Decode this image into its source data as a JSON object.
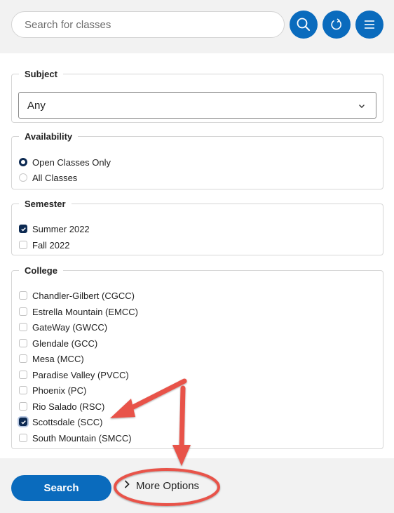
{
  "header": {
    "search_placeholder": "Search for classes",
    "buttons": [
      {
        "name": "search",
        "icon": "search-icon"
      },
      {
        "name": "reset",
        "icon": "refresh-icon"
      },
      {
        "name": "menu",
        "icon": "hamburger-menu-icon"
      }
    ]
  },
  "filters": {
    "subject": {
      "legend": "Subject",
      "selected": "Any",
      "icon": "chevron-down-icon"
    },
    "availability": {
      "legend": "Availability",
      "options": [
        {
          "label": "Open Classes Only",
          "selected": true
        },
        {
          "label": "All Classes",
          "selected": false
        }
      ]
    },
    "semester": {
      "legend": "Semester",
      "options": [
        {
          "label": "Summer 2022",
          "checked": true
        },
        {
          "label": "Fall 2022",
          "checked": false
        }
      ]
    },
    "college": {
      "legend": "College",
      "options": [
        {
          "label": "Chandler-Gilbert (CGCC)",
          "checked": false
        },
        {
          "label": "Estrella Mountain (EMCC)",
          "checked": false
        },
        {
          "label": "GateWay (GWCC)",
          "checked": false
        },
        {
          "label": "Glendale (GCC)",
          "checked": false
        },
        {
          "label": "Mesa (MCC)",
          "checked": false
        },
        {
          "label": "Paradise Valley (PVCC)",
          "checked": false
        },
        {
          "label": "Phoenix (PC)",
          "checked": false
        },
        {
          "label": "Rio Salado (RSC)",
          "checked": false
        },
        {
          "label": "Scottsdale (SCC)",
          "checked": true
        },
        {
          "label": "South Mountain (SMCC)",
          "checked": false
        }
      ]
    }
  },
  "footer": {
    "search_label": "Search",
    "more_options_label": "More Options",
    "more_options_icon": "chevron-right-icon"
  },
  "colors": {
    "primary": "#0a6bbd",
    "checked": "#0d2a52",
    "annotation": "#e8534a",
    "toolbar_bg": "#f2f2f2"
  }
}
